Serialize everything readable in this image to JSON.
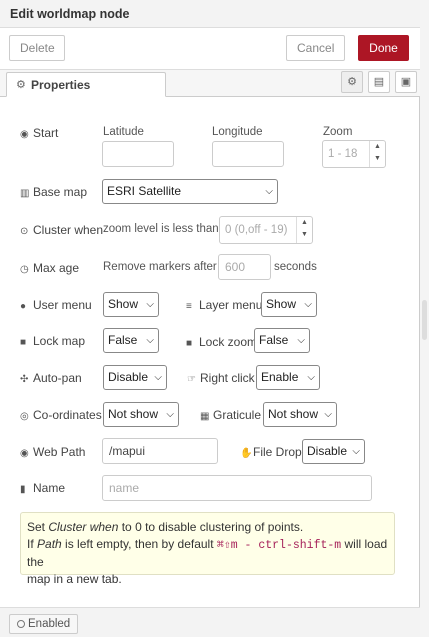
{
  "title": "Edit worldmap node",
  "buttons": {
    "delete": "Delete",
    "cancel": "Cancel",
    "done": "Done"
  },
  "tab": {
    "label": "Properties"
  },
  "start": {
    "label": "Start",
    "latitude_label": "Latitude",
    "longitude_label": "Longitude",
    "zoom_label": "Zoom",
    "latitude_value": "",
    "longitude_value": "",
    "zoom_placeholder": "1 - 18"
  },
  "basemap": {
    "label": "Base map",
    "selected": "ESRI Satellite"
  },
  "cluster": {
    "label": "Cluster when",
    "text": "zoom level is less than",
    "placeholder": "0 (0,off - 19)"
  },
  "maxage": {
    "label": "Max age",
    "text": "Remove markers after",
    "placeholder": "600",
    "unit": "seconds"
  },
  "usermenu": {
    "label": "User menu",
    "selected": "Show"
  },
  "layermenu": {
    "label": "Layer menu",
    "selected": "Show"
  },
  "lockmap": {
    "label": "Lock map",
    "selected": "False"
  },
  "lockzoom": {
    "label": "Lock zoom",
    "selected": "False"
  },
  "autopan": {
    "label": "Auto-pan",
    "selected": "Disable"
  },
  "rightclick": {
    "label": "Right click",
    "selected": "Enable"
  },
  "coordinates": {
    "label": "Co-ordinates",
    "selected": "Not show"
  },
  "graticule": {
    "label": "Graticule",
    "selected": "Not show"
  },
  "webpath": {
    "label": "Web Path",
    "value": "/mapui"
  },
  "filedrop": {
    "label": "File Drop",
    "selected": "Disable"
  },
  "name": {
    "label": "Name",
    "placeholder": "name"
  },
  "note": {
    "l1a": "Set ",
    "l1b": "Cluster when",
    "l1c": " to 0 to disable clustering of points.",
    "l2a": "If ",
    "l2b": "Path",
    "l2c": " is left empty, then by default ",
    "l2d": "⌘⇧m - ctrl-shift-m",
    "l2e": " will load the",
    "l3": "map in a new tab."
  },
  "footer": {
    "enabled": "Enabled"
  }
}
